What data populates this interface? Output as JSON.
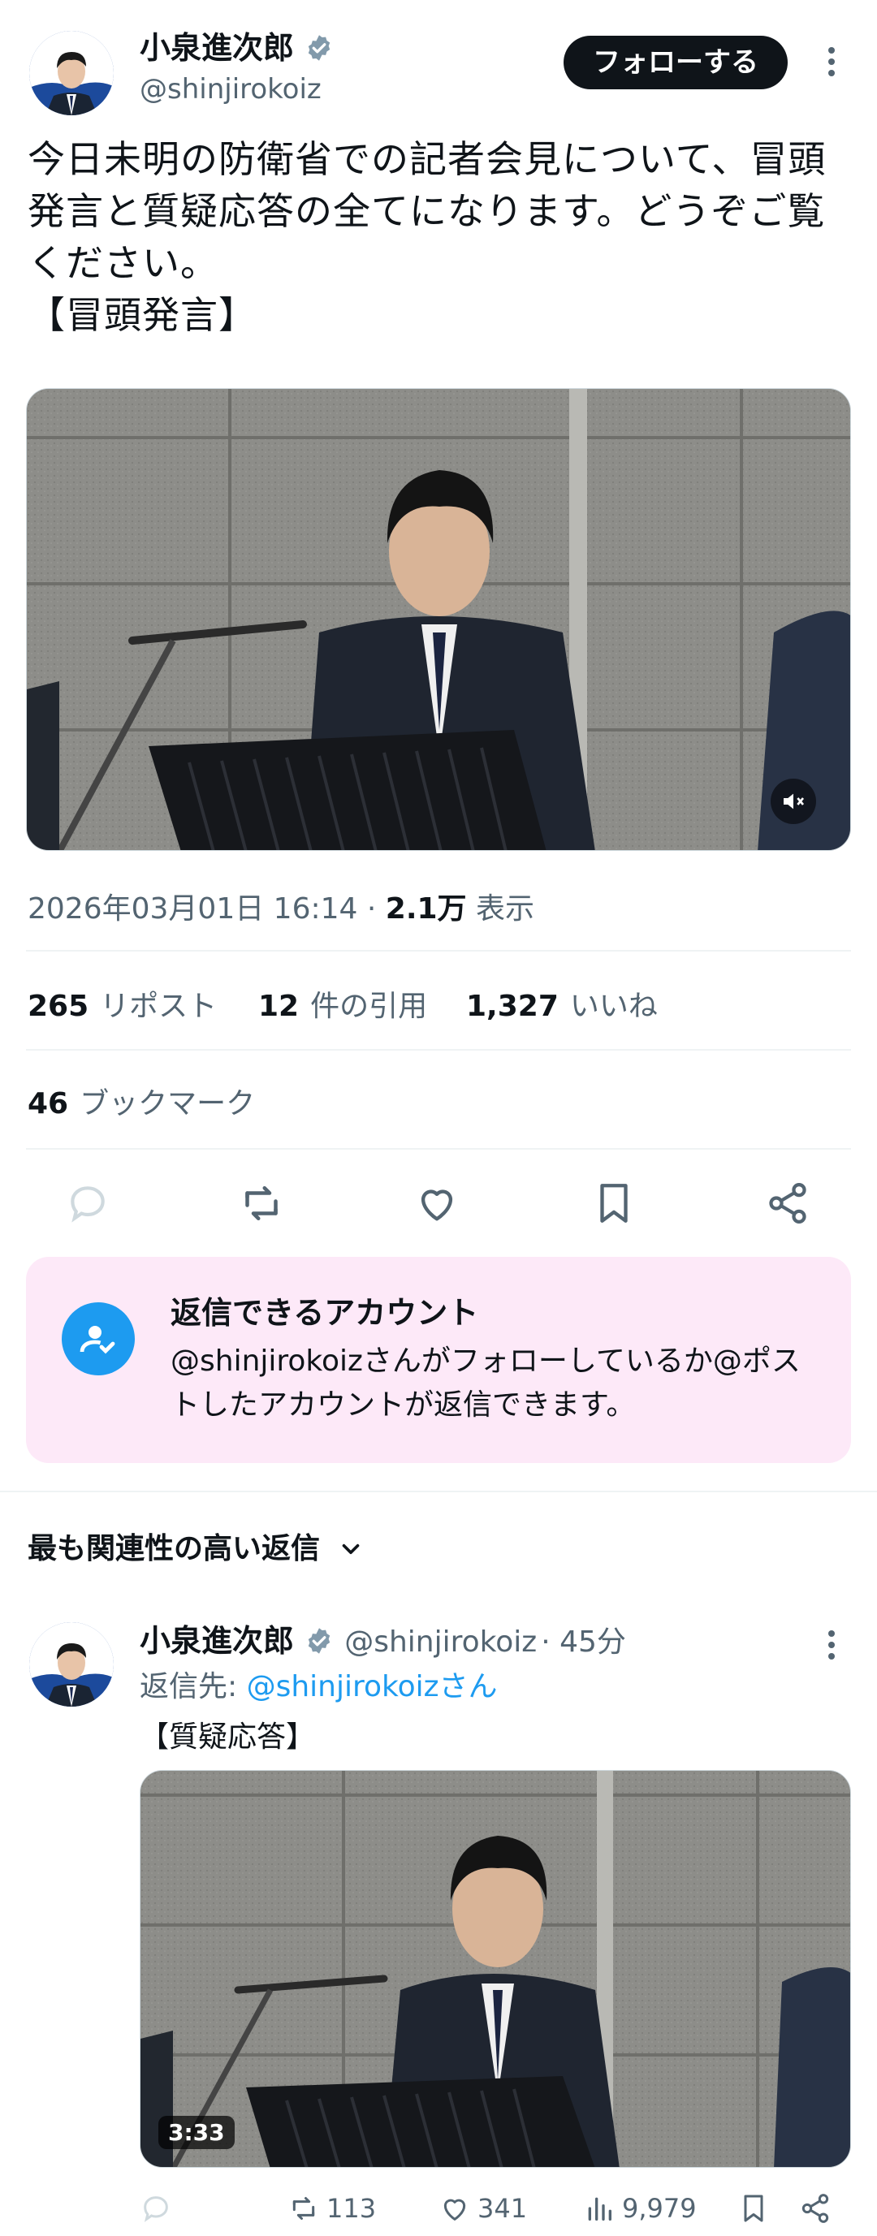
{
  "post": {
    "author": {
      "display_name": "小泉進次郎",
      "handle": "@shinjirokoiz"
    },
    "follow_label": "フォローする",
    "text": "今日未明の防衛省での記者会見について、冒頭発言と質疑応答の全てになります。どうぞご覧ください。\n【冒頭発言】",
    "timestamp": "2026年03月01日 16:14",
    "views_count": "2.1万",
    "views_label": "表示",
    "stats": {
      "reposts_count": "265",
      "reposts_label": "リポスト",
      "quotes_count": "12",
      "quotes_label": "件の引用",
      "likes_count": "1,327",
      "likes_label": "いいね",
      "bookmarks_count": "46",
      "bookmarks_label": "ブックマーク"
    }
  },
  "reply_restriction": {
    "title": "返信できるアカウント",
    "description": "@shinjirokoizさんがフォローしているか@ポストしたアカウントが返信できます。"
  },
  "replies_section": {
    "sort_label": "最も関連性の高い返信"
  },
  "reply": {
    "display_name": "小泉進次郎",
    "handle": "@shinjirokoiz",
    "time": "45分",
    "replying_to_prefix": "返信先:",
    "replying_to": "@shinjirokoizさん",
    "text": "【質疑応答】",
    "video_duration": "3:33",
    "reposts": "113",
    "likes": "341",
    "views": "9,979"
  },
  "colors": {
    "accent": "#1d9bf0",
    "text_primary": "#0f1419",
    "text_secondary": "#536471",
    "reply_box_bg": "#fde9f8"
  }
}
